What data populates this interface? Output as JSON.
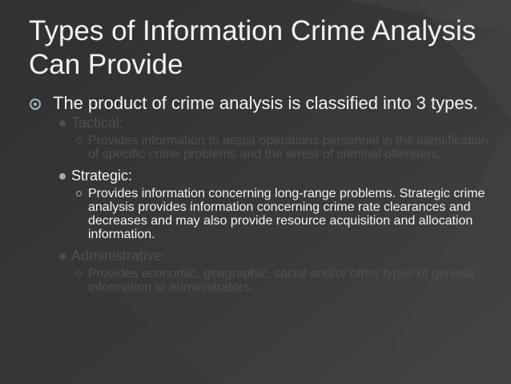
{
  "slide": {
    "title": "Types of Information Crime Analysis Can Provide",
    "intro": "The product of crime analysis is classified into 3 types.",
    "sections": [
      {
        "heading": "Tactical:",
        "detail": "Provides information to assist operations personnel in the identification of specific crime problems and the arrest of criminal offenders."
      },
      {
        "heading": "Strategic:",
        "detail": "Provides information concerning long-range problems. Strategic crime analysis provides information concerning crime rate clearances and decreases and may also provide resource acquisition and allocation information."
      },
      {
        "heading": "Administrative:",
        "detail": "Provides economic, geographic, social and/or other types of general information to administrators."
      }
    ]
  },
  "colors": {
    "background": "#3a3a3a",
    "title_text": "#f2f2f2",
    "highlight_text": "#f4f4f4",
    "dimmed_text": "#4f4f4f",
    "bullet_accent": "#8eb2c0"
  }
}
